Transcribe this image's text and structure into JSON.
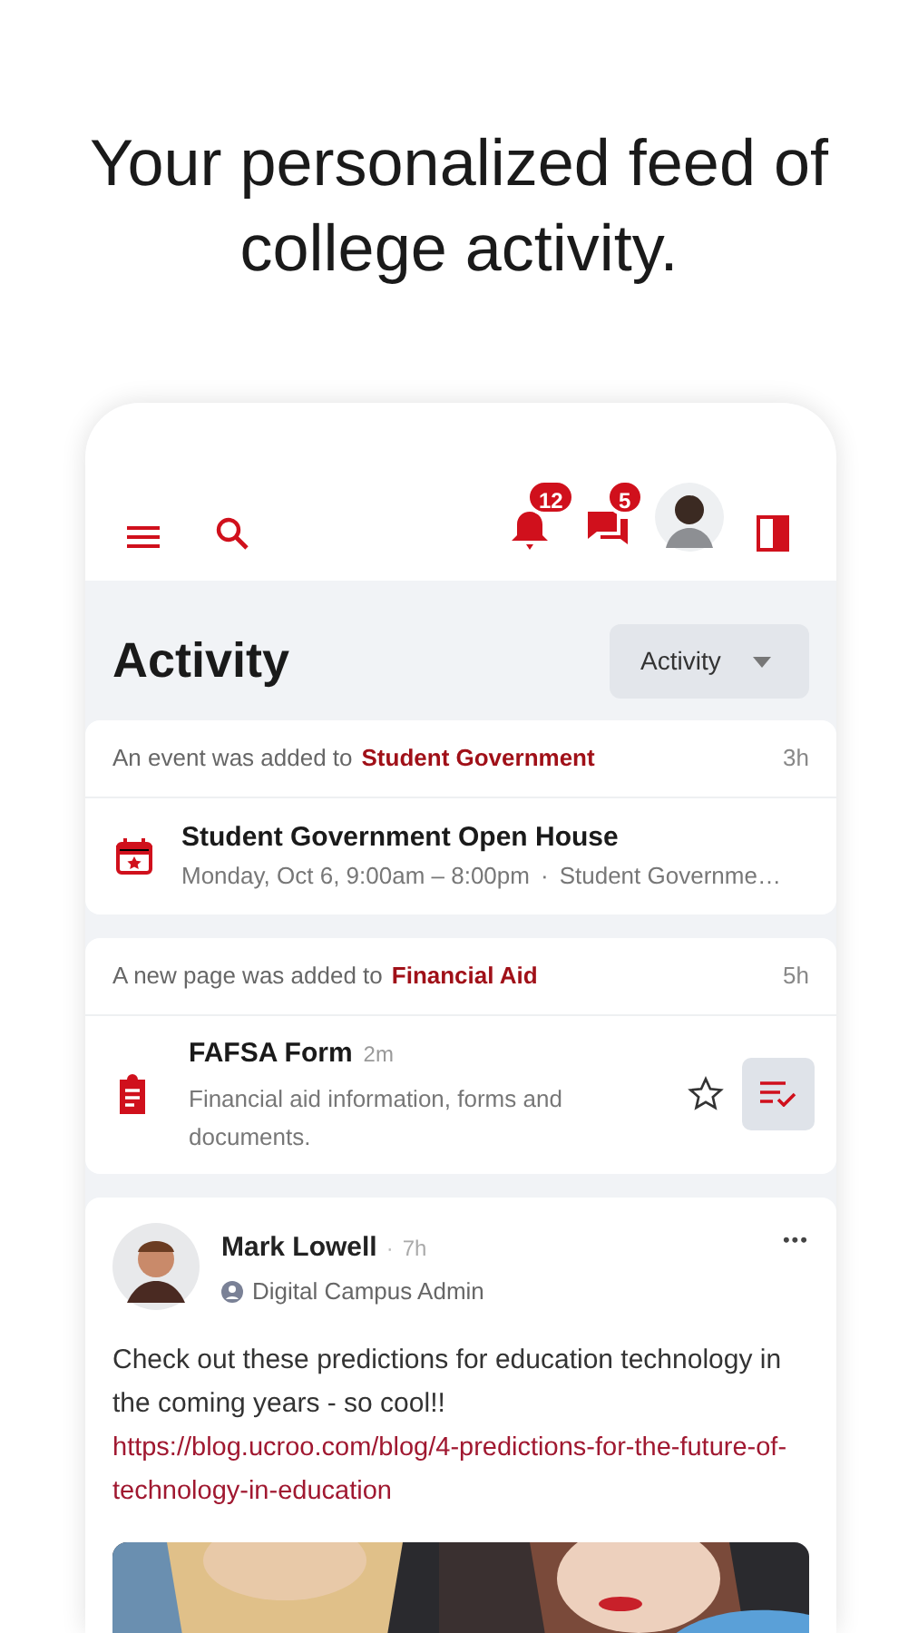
{
  "headline": "Your personalized feed of college activity.",
  "toolbar": {
    "notifications_badge": "12",
    "messages_badge": "5"
  },
  "page": {
    "title": "Activity",
    "filter": "Activity"
  },
  "feed": [
    {
      "kind": "event",
      "prefix": "An event was added to",
      "group": "Student Government",
      "time": "3h",
      "title": "Student Government Open House",
      "detail": "Monday, Oct 6, 9:00am – 8:00pm",
      "separator": "·",
      "place": "Student Governme…"
    },
    {
      "kind": "page",
      "prefix": "A new page was added to",
      "group": "Financial Aid",
      "time": "5h",
      "title": "FAFSA Form",
      "age": "2m",
      "detail": "Financial aid information, forms and documents.",
      "starred": false
    }
  ],
  "post": {
    "author": "Mark Lowell",
    "separator": "·",
    "time": "7h",
    "role": "Digital Campus Admin",
    "more": "•••",
    "text": "Check out these predictions for education technology in the coming years - so cool!!",
    "link": "https://blog.ucroo.com/blog/4-predictions-for-the-future-of-technology-in-education"
  }
}
